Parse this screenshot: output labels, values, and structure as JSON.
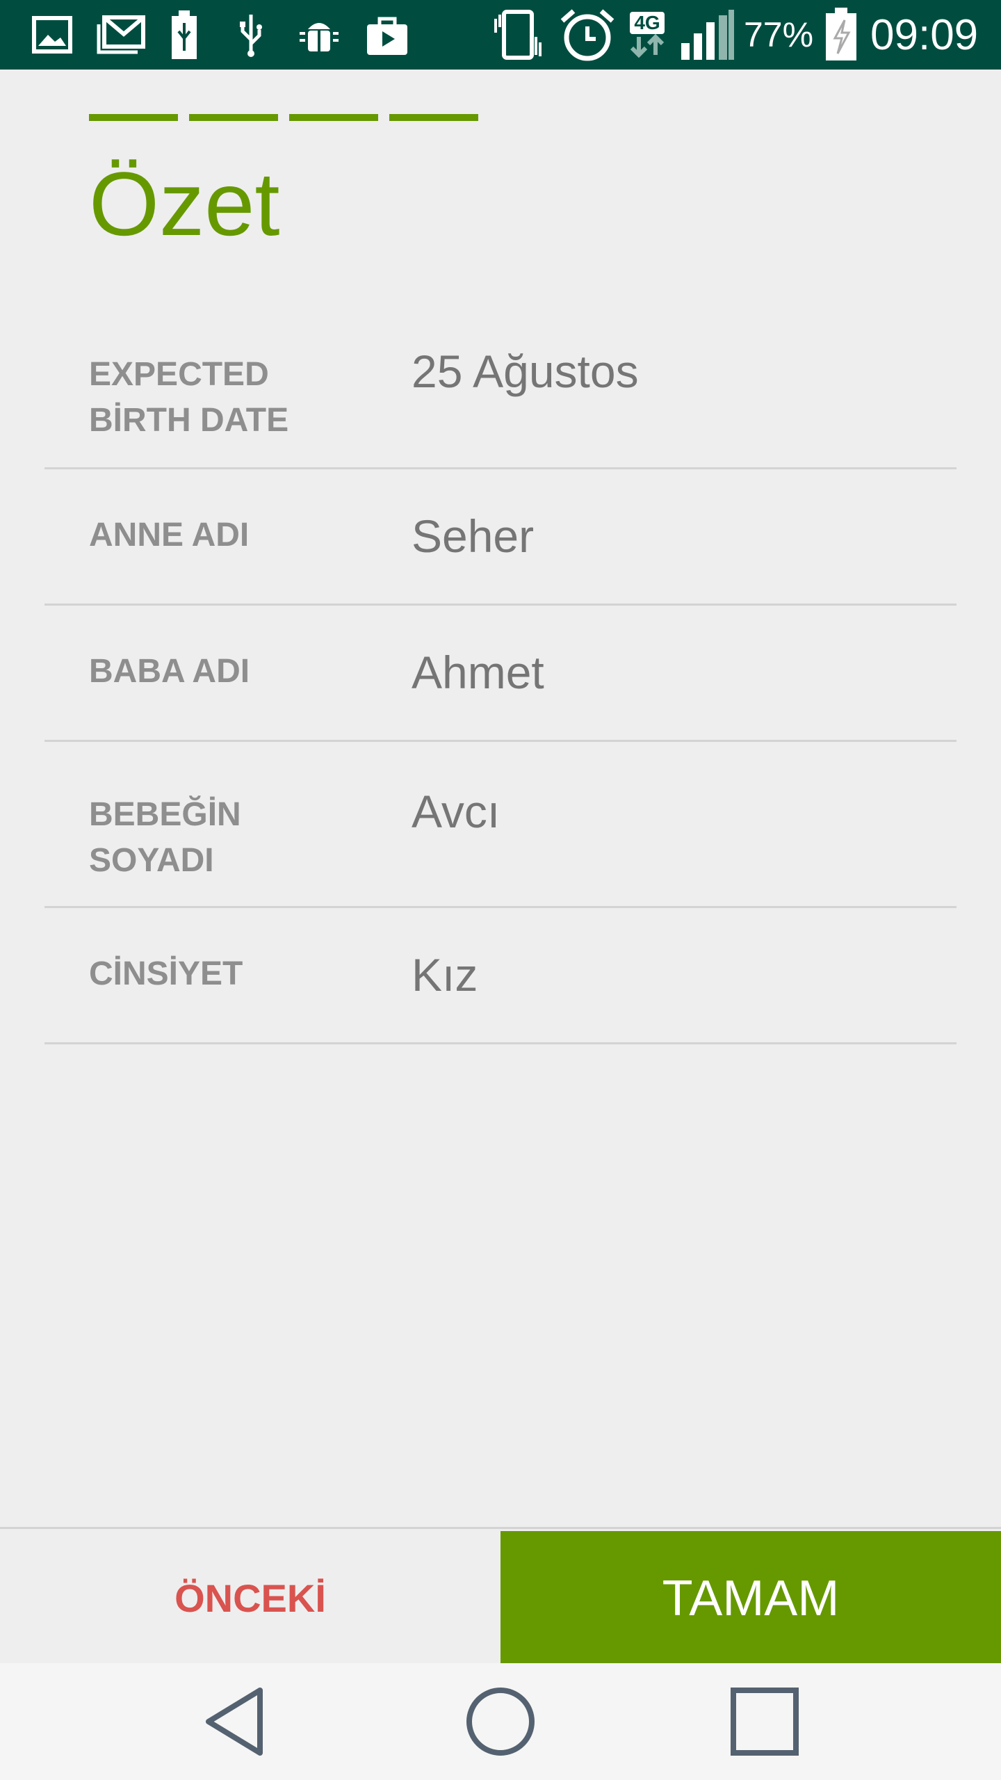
{
  "status_bar": {
    "battery_percent": "77%",
    "time": "09:09",
    "network": "4G",
    "left_icons": [
      "image-icon",
      "gmail-icon",
      "battery-usb-icon",
      "usb-icon",
      "android-debug-icon",
      "shopping-bag-icon"
    ],
    "right_icons": [
      "vibrate-icon",
      "alarm-icon",
      "network-4g-icon",
      "signal-icon",
      "battery-charging-icon"
    ]
  },
  "wizard": {
    "steps_total": 4,
    "steps_completed": 4,
    "title": "Özet"
  },
  "summary": {
    "rows": [
      {
        "label": "EXPECTED BİRTH DATE",
        "value": "25 Ağustos"
      },
      {
        "label": "ANNE ADI",
        "value": "Seher"
      },
      {
        "label": "BABA ADI",
        "value": "Ahmet"
      },
      {
        "label": "BEBEĞİN SOYADI",
        "value": "Avcı"
      },
      {
        "label": "CİNSİYET",
        "value": "Kız"
      }
    ]
  },
  "buttons": {
    "previous_label": "ÖNCEKİ",
    "done_label": "TAMAM"
  },
  "colors": {
    "status_bar": "#004d40",
    "accent_green": "#669900",
    "previous_red": "#d9534f",
    "label_gray": "#8e8e8e",
    "value_gray": "#757575"
  }
}
